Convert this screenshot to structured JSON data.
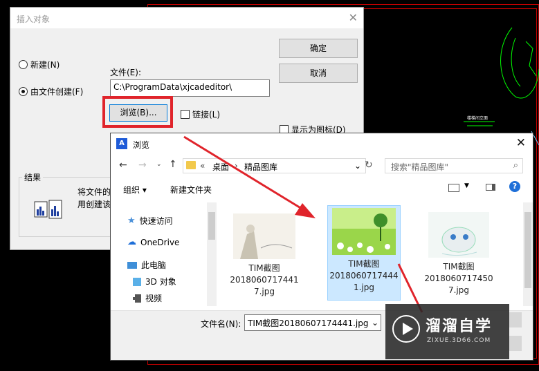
{
  "insert_dialog": {
    "title": "插入对象",
    "radio_new": "新建(N)",
    "radio_from_file": "由文件创建(F)",
    "file_label": "文件(E):",
    "file_path": "C:\\ProgramData\\xjcadeditor\\",
    "browse_label": "浏览(B)...",
    "link_label": "链接(L)",
    "ok_label": "确定",
    "cancel_label": "取消",
    "show_icon_label": "显示为图标(D)",
    "result_label": "结果",
    "result_text_line1": "将文件的",
    "result_text_line2": "用创建该"
  },
  "browse_dialog": {
    "title": "浏览",
    "breadcrumb": [
      "桌面",
      "精品图库"
    ],
    "search_placeholder": "搜索\"精品图库\"",
    "organize_label": "组织 ▾",
    "new_folder_label": "新建文件夹",
    "nav_items": [
      {
        "label": "快速访问",
        "icon": "star-icon"
      },
      {
        "label": "OneDrive",
        "icon": "cloud-icon"
      },
      {
        "label": "此电脑",
        "icon": "computer-icon"
      },
      {
        "label": "3D 对象",
        "icon": "cube-icon"
      },
      {
        "label": "视频",
        "icon": "video-icon"
      }
    ],
    "files": [
      {
        "line1": "TIM截图",
        "line2": "2018060717441",
        "line3": "7.jpg"
      },
      {
        "line1": "TIM截图",
        "line2": "2018060717444",
        "line3": "1.jpg"
      },
      {
        "line1": "TIM截图",
        "line2": "2018060717450",
        "line3": "7.jpg"
      }
    ],
    "filename_label": "文件名(N):",
    "filename_value": "TIM截图20180607174441.jpg"
  },
  "cad": {
    "annotation": "楼梯间立面"
  },
  "watermark": {
    "brand": "溜溜自学",
    "url": "ZIXUE.3D66.COM"
  },
  "colors": {
    "highlight_red": "#e0242b",
    "cad_green": "#00ff00",
    "cad_red": "#c00000",
    "selection_blue": "#cce8ff"
  }
}
